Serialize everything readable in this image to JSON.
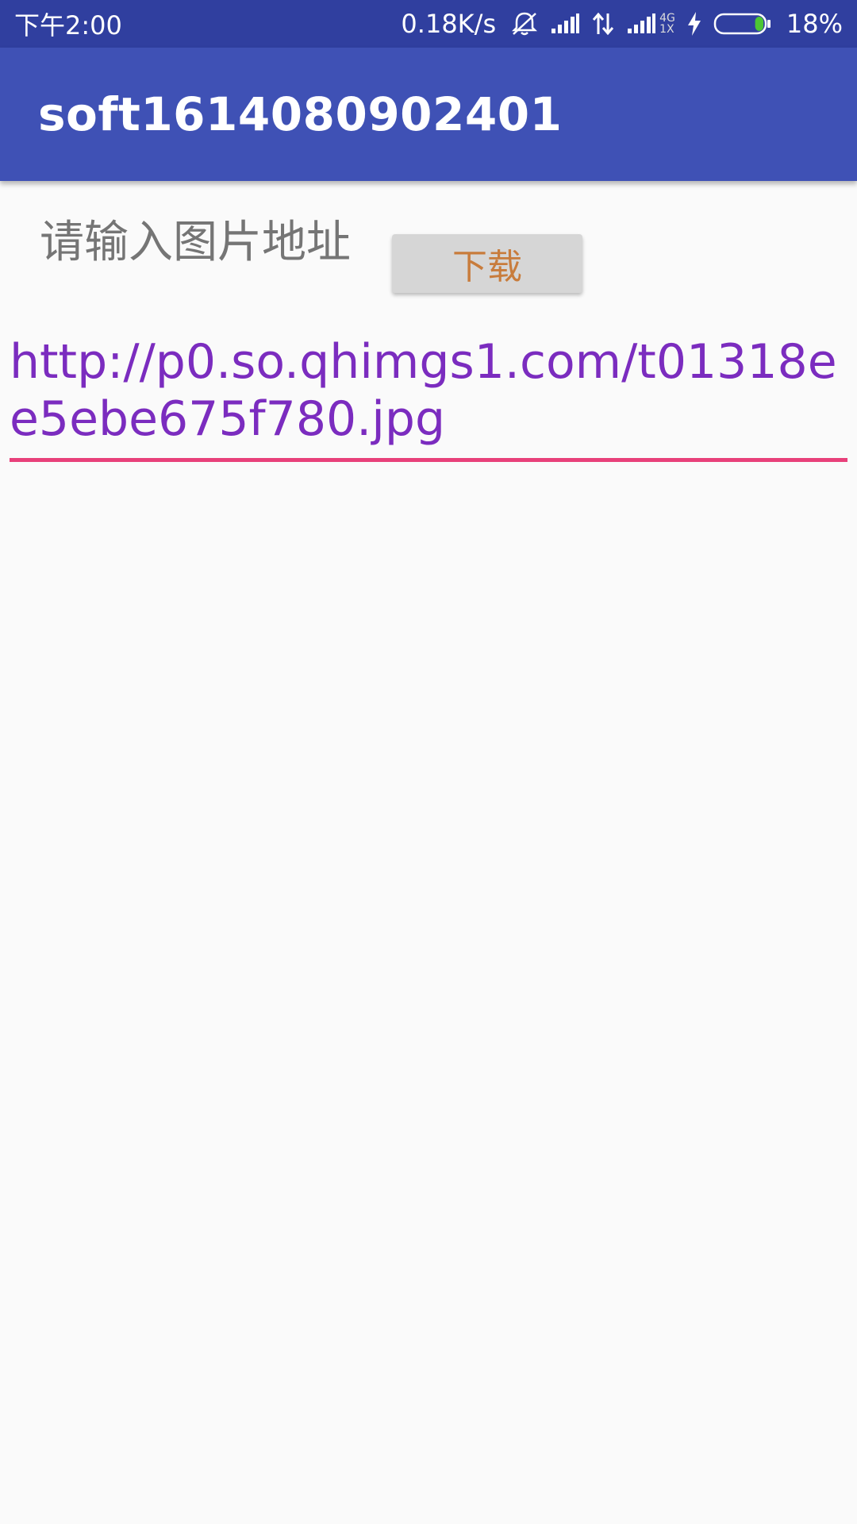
{
  "status_bar": {
    "time": "下午2:00",
    "net_speed": "0.18K/s",
    "battery_percent": "18%",
    "battery_level": 0.18,
    "icons": [
      "mute-vibrate-icon",
      "signal-icon",
      "data-transfer-icon",
      "signal-4g-icon",
      "charging-icon",
      "battery-icon"
    ],
    "network_label_top": "4G",
    "network_label_bottom": "1X",
    "colors": {
      "background": "#303f9f",
      "battery_fill": "#4cc634"
    }
  },
  "app_bar": {
    "title": "soft1614080902401",
    "background": "#3f51b5"
  },
  "main": {
    "prompt_label": "请输入图片地址",
    "download_button_label": "下载",
    "url_value": "http://p0.so.qhimgs1.com/t01318ee5ebe675f780.jpg",
    "accent_color": "#e8407a",
    "url_text_color": "#7b2cbf"
  }
}
